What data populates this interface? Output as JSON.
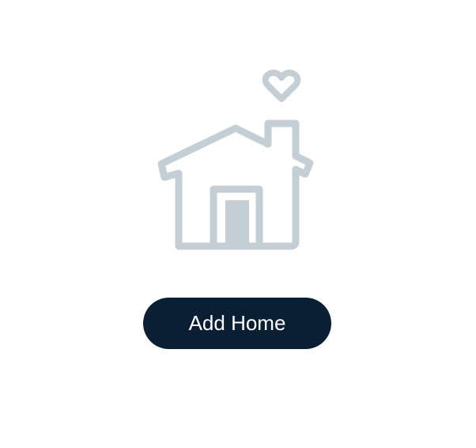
{
  "empty_state": {
    "illustration_icon": "house-with-heart-icon",
    "illustration_color": "#c3ced5",
    "add_home_label": "Add Home",
    "button_color": "#0a1f33"
  }
}
